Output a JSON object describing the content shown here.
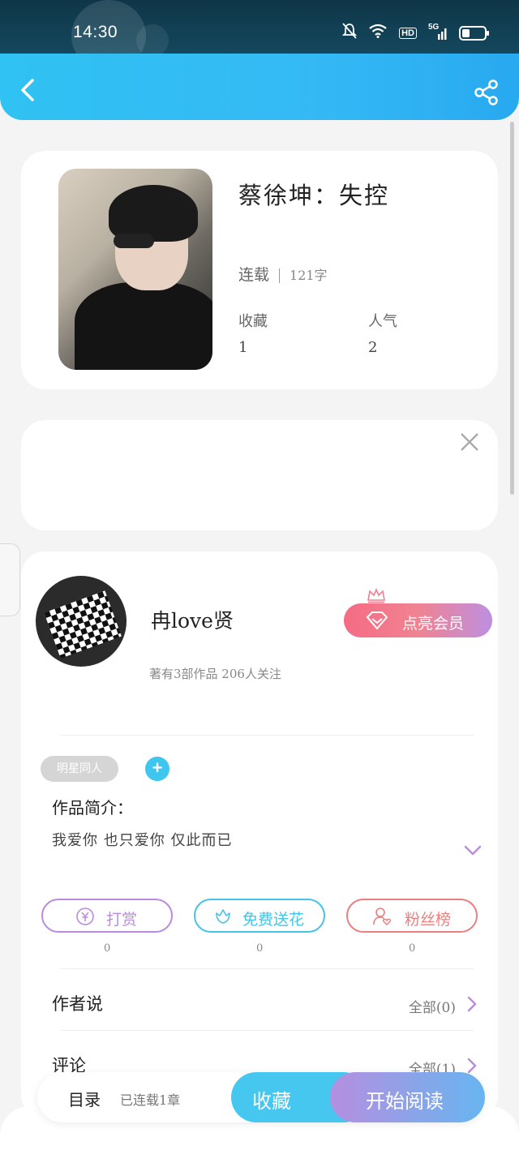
{
  "status_bar": {
    "time": "14:30",
    "network": "5G",
    "hd": "HD"
  },
  "book": {
    "title": "蔡徐坤：失控",
    "status": "连载",
    "word_count": "121字",
    "favorites_label": "收藏",
    "favorites_value": "1",
    "popularity_label": "人气",
    "popularity_value": "2"
  },
  "author": {
    "name": "冉love贤",
    "summary": "著有3部作品 206人关注",
    "vip_label": "点亮会员"
  },
  "tags": [
    "明星同人"
  ],
  "intro": {
    "heading": "作品简介：",
    "text": "我爱你 也只爱你 仅此而已"
  },
  "actions": [
    {
      "label": "打赏",
      "count": "0",
      "color": "#b98ce0"
    },
    {
      "label": "免费送花",
      "count": "0",
      "color": "#45c4e8"
    },
    {
      "label": "粉丝榜",
      "count": "0",
      "color": "#ea7f7f"
    }
  ],
  "author_note": {
    "label": "作者说",
    "all": "全部(0)"
  },
  "comments": {
    "label": "评论",
    "all": "全部(1)"
  },
  "bottom_bar": {
    "toc": "目录",
    "serial_status": "已连载1章",
    "collect": "收藏",
    "start_reading": "开始阅读"
  },
  "icons": [
    "back-icon",
    "share-icon",
    "close-icon",
    "plus-icon",
    "chevron-down-icon",
    "chevron-right-icon",
    "crown-icon",
    "diamond-icon",
    "yuan-icon",
    "flower-icon",
    "user-heart-icon"
  ]
}
